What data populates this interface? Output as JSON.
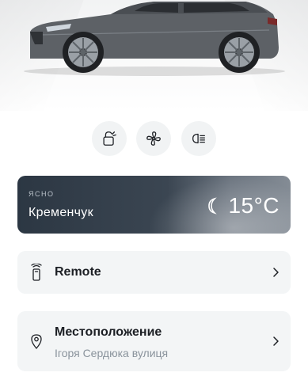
{
  "quick_actions": [
    {
      "icon": "door-lock-icon"
    },
    {
      "icon": "fan-icon"
    },
    {
      "icon": "headlights-icon"
    }
  ],
  "weather": {
    "condition": "ЯСНО",
    "city": "Кременчук",
    "temperature": "15°C",
    "icon": "moon-icon"
  },
  "remote": {
    "title": "Remote",
    "icon": "key-fob-icon"
  },
  "location": {
    "title": "Местоположение",
    "address": "Ігоря Сердюка вулиця",
    "icon": "map-pin-icon"
  },
  "colors": {
    "card_bg": "#f3f5f6",
    "weather_dark": "#2c3743",
    "text_primary": "#1c1f24",
    "text_secondary": "#8a939c"
  }
}
